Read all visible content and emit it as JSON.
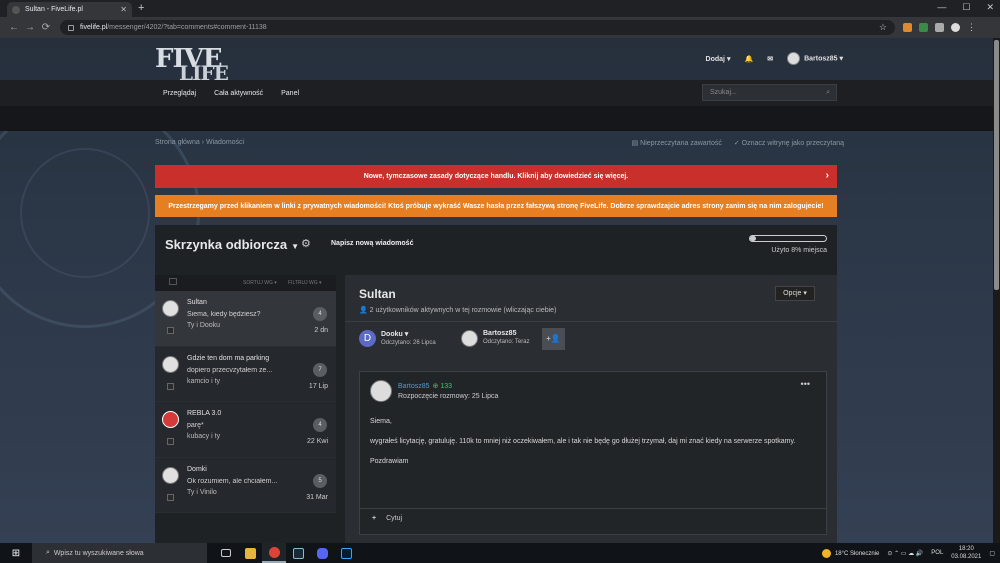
{
  "browser": {
    "tab_title": "Sultan - FiveLife.pl",
    "new_tab": "+",
    "url_domain": "fivelife.pl",
    "url_path": "/messenger/4202/?tab=comments#comment-11138"
  },
  "site": {
    "logo_main": "FIVE",
    "logo_sub": "LIFE",
    "header": {
      "add_label": "Dodaj",
      "username": "Bartosz85"
    },
    "nav": [
      "Przeglądaj",
      "Cała aktywność",
      "Panel"
    ],
    "search_placeholder": "Szukaj...",
    "breadcrumb": "Strona główna › Wiadomości",
    "unread_label": "Nieprzeczytana zawartość",
    "mark_read_label": "Oznacz witrynę jako przeczytaną",
    "alert_red": "Nowe, tymczasowe zasady dotyczące handlu. Kliknij aby dowiedzieć się więcej.",
    "alert_orange": "Przestrzegamy przed klikaniem w linki z prywatnych wiadomości! Ktoś próbuje wykraść Wasze hasła przez fałszywą stronę FiveLife. Dobrze sprawdzajcie adres strony zanim się na nim zalogujecie!"
  },
  "messenger": {
    "title": "Skrzynka odbiorcza",
    "new_message": "Napisz nową wiadomość",
    "quota_text": "Użyto 8% miejsca",
    "quota_percent": 8,
    "sort_label": "SORTUJ WG",
    "filter_label": "FILTRUJ WG",
    "conversations": [
      {
        "title": "Sultan",
        "snippet": "Siema, kiedy będziesz?",
        "participants": "Ty i Dooku",
        "count": "4",
        "date": "2 dn"
      },
      {
        "title": "Gdzie ten dom ma parking",
        "snippet": "dopiero przecvzytałem ze...",
        "participants": "kamcio i ty",
        "count": "7",
        "date": "17 Lip"
      },
      {
        "title": "REBLA 3.0",
        "snippet": "parę*",
        "participants": "kubacy i ty",
        "count": "4",
        "date": "22 Kwi"
      },
      {
        "title": "Domki",
        "snippet": "Ok rozumiem, ale chciałem...",
        "participants": "Ty i Vinilo",
        "count": "5",
        "date": "31 Mar"
      }
    ],
    "thread": {
      "title": "Sultan",
      "subtitle": "2 użytkowników aktywnych w tej rozmowie (wliczając ciebie)",
      "options_label": "Opcje",
      "participants": [
        {
          "initial": "D",
          "name": "Dooku",
          "read": "Odczytano: 26 Lipca"
        },
        {
          "initial": "",
          "name": "Bartosz85",
          "read": "Odczytano: Teraz"
        }
      ],
      "post": {
        "author": "Bartosz85",
        "reputation": "133",
        "started": "Rozpoczęcie rozmowy: 25 Lipca",
        "lines": [
          "Siema,",
          "wygrałeś licytację, gratuluję. 110k to mniej niż oczekiwałem, ale i tak nie będę go dłużej trzymał, daj mi znać kiedy na serwerze spotkamy.",
          "Pozdrawiam"
        ],
        "quote_label": "Cytuj"
      }
    }
  },
  "taskbar": {
    "search_placeholder": "Wpisz tu wyszukiwane słowa",
    "weather": "18°C  Słonecznie",
    "lang": "POL",
    "time": "18:20",
    "date": "03.08.2021"
  }
}
